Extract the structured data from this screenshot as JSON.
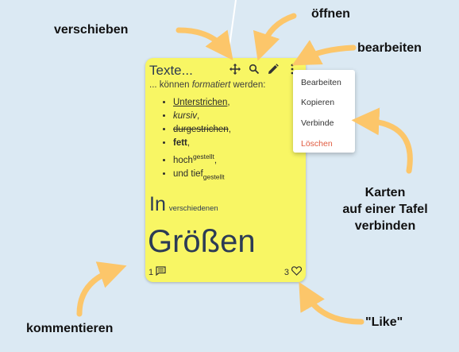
{
  "card": {
    "title": "Texte...",
    "intro_prefix": "... können ",
    "intro_em": "formatiert",
    "intro_suffix": " werden:",
    "formats": {
      "underline": "Unterstrichen",
      "italic": "kursiv",
      "strike": "durgestrichen",
      "bold": "fett",
      "sup_base": "hoch",
      "sup": "gestellt",
      "sub_base": "und tief",
      "sub": "gestellt",
      "comma": ","
    },
    "size_large": "In",
    "size_small": "verschiedenen",
    "size_huge": "Größen",
    "comments_count": "1",
    "likes_count": "3"
  },
  "menu": {
    "items": [
      "Bearbeiten",
      "Kopieren",
      "Verbinde",
      "Löschen"
    ]
  },
  "labels": {
    "move": "verschieben",
    "open": "öffnen",
    "edit": "bearbeiten",
    "connect_1": "Karten",
    "connect_2": "auf einer Tafel",
    "connect_3": "verbinden",
    "comment": "kommentieren",
    "like": "\"Like\""
  },
  "icons": {
    "move": "move-icon",
    "open": "search-icon",
    "edit": "pencil-icon",
    "more": "more-vertical-icon",
    "comment": "comment-icon",
    "like": "heart-icon"
  },
  "colors": {
    "background": "#dbe9f3",
    "card": "#f8f664",
    "arrow": "#fcc66a",
    "danger": "#e05a3f"
  }
}
